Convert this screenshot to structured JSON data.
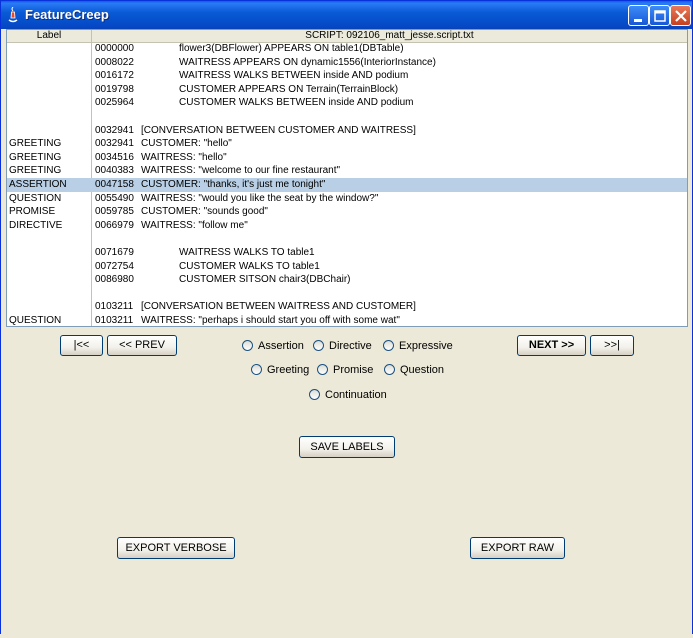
{
  "window": {
    "title": "FeatureCreep"
  },
  "table": {
    "col_label": "Label",
    "col_script": "SCRIPT: 092106_matt_jesse.script.txt",
    "rows": [
      {
        "label": "",
        "ts": "0000000",
        "text": "flower3(DBFlower) APPEARS ON table1(DBTable)",
        "indent": true
      },
      {
        "label": "",
        "ts": "0008022",
        "text": "WAITRESS APPEARS ON dynamic1556(InteriorInstance)",
        "indent": true
      },
      {
        "label": "",
        "ts": "0016172",
        "text": "WAITRESS WALKS BETWEEN inside AND podium",
        "indent": true
      },
      {
        "label": "",
        "ts": "0019798",
        "text": "CUSTOMER APPEARS ON Terrain(TerrainBlock)",
        "indent": true
      },
      {
        "label": "",
        "ts": "0025964",
        "text": "CUSTOMER WALKS BETWEEN inside AND podium",
        "indent": true
      },
      {
        "label": "",
        "ts": "",
        "text": "",
        "indent": false
      },
      {
        "label": "",
        "ts": "0032941",
        "text": "[CONVERSATION BETWEEN CUSTOMER AND WAITRESS]",
        "indent": false
      },
      {
        "label": "GREETING",
        "ts": "0032941",
        "text": "CUSTOMER: \"hello\"",
        "indent": false
      },
      {
        "label": "GREETING",
        "ts": "0034516",
        "text": "WAITRESS: \"hello\"",
        "indent": false
      },
      {
        "label": "GREETING",
        "ts": "0040383",
        "text": "WAITRESS: \"welcome to our fine restaurant\"",
        "indent": false
      },
      {
        "label": "ASSERTION",
        "ts": "0047158",
        "text": "CUSTOMER: \"thanks, it's just me tonight\"",
        "indent": false,
        "selected": true
      },
      {
        "label": "QUESTION",
        "ts": "0055490",
        "text": "WAITRESS: \"would you like the seat by the window?\"",
        "indent": false
      },
      {
        "label": "PROMISE",
        "ts": "0059785",
        "text": "CUSTOMER: \"sounds good\"",
        "indent": false
      },
      {
        "label": "DIRECTIVE",
        "ts": "0066979",
        "text": "WAITRESS: \"follow me\"",
        "indent": false
      },
      {
        "label": "",
        "ts": "",
        "text": "",
        "indent": false
      },
      {
        "label": "",
        "ts": "0071679",
        "text": "WAITRESS WALKS TO table1",
        "indent": true
      },
      {
        "label": "",
        "ts": "0072754",
        "text": "CUSTOMER WALKS TO table1",
        "indent": true
      },
      {
        "label": "",
        "ts": "0086980",
        "text": "CUSTOMER SITSON chair3(DBChair)",
        "indent": true
      },
      {
        "label": "",
        "ts": "",
        "text": "",
        "indent": false
      },
      {
        "label": "",
        "ts": "0103211",
        "text": "[CONVERSATION BETWEEN WAITRESS AND CUSTOMER]",
        "indent": false
      },
      {
        "label": "QUESTION",
        "ts": "0103211",
        "text": "WAITRESS: \"perhaps i should start you off with some wat\"",
        "indent": false
      }
    ]
  },
  "nav": {
    "first": "|<<",
    "prev": "<< PREV",
    "next": "NEXT >>",
    "last": ">>|"
  },
  "labels": {
    "assertion": "Assertion",
    "directive": "Directive",
    "expressive": "Expressive",
    "greeting": "Greeting",
    "promise": "Promise",
    "question": "Question",
    "continuation": "Continuation"
  },
  "actions": {
    "save": "SAVE LABELS",
    "export_verbose": "EXPORT VERBOSE",
    "export_raw": "EXPORT RAW"
  },
  "colors": {
    "selection": "#b8cfe5",
    "titlebar": "#0a5bd6"
  }
}
